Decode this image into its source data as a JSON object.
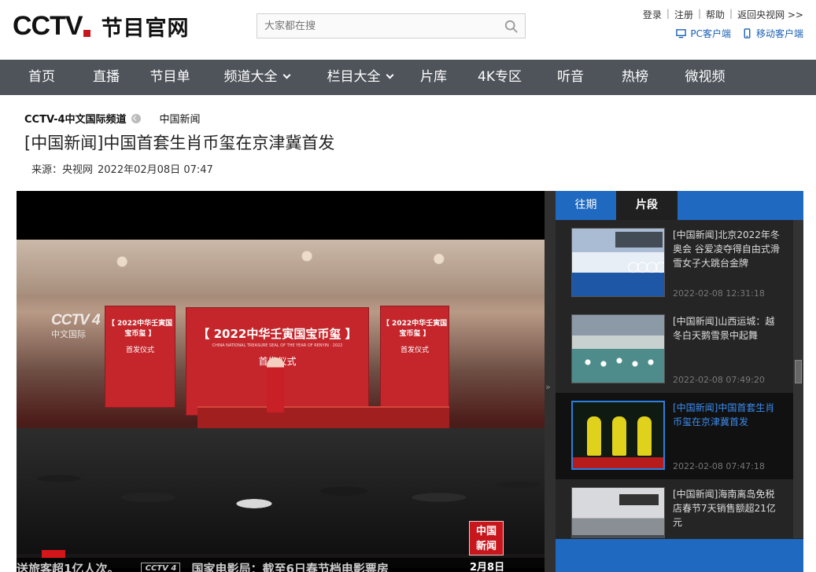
{
  "header": {
    "logo_main": "CCTV",
    "logo_sub": "节目官网",
    "search_placeholder": "大家都在搜",
    "top_links": [
      "登录",
      "注册",
      "帮助",
      "返回央视网 >>"
    ],
    "clients": [
      "PC客户端",
      "移动客户端"
    ]
  },
  "nav": {
    "items": [
      "首页",
      "直播",
      "节目单",
      "频道大全",
      "栏目大全",
      "片库",
      "4K专区",
      "听音",
      "热榜",
      "微视频"
    ]
  },
  "article": {
    "channel": "CCTV-4中文国际频道",
    "column": "中国新闻",
    "title": "[中国新闻]中国首套生肖币玺在京津冀首发",
    "source": "来源：央视网",
    "datetime": "2022年02月08日 07:47"
  },
  "video": {
    "watermark_logo": "CCTV 4",
    "watermark_sub": "中文国际",
    "panel_main_title": "【 2022中华壬寅国宝币玺 】",
    "panel_main_en": "CHINA NATIONAL TREASURE SEAL OF THE YEAR OF RENYIN · 2022",
    "panel_main_sub": "首发仪式",
    "panel_side_title": "【 2022中华壬寅国宝币玺 】",
    "panel_side_sub": "首发仪式",
    "ticker_left": "送旅客超1亿人次。",
    "ticker_bug": "CCTV 4",
    "ticker_right": "国家电影局：截至6日春节档电影票房",
    "badge_line1": "中国",
    "badge_line2": "新闻",
    "date": "2月8日"
  },
  "sidebar": {
    "tabs": [
      "往期",
      "片段"
    ],
    "active_tab": "片段",
    "items": [
      {
        "title": "[中国新闻]北京2022年冬奥会 谷爱凌夺得自由式滑雪女子大跳台金牌",
        "time": "2022-02-08 12:31:18"
      },
      {
        "title": "[中国新闻]山西运城：越冬白天鹅雪景中起舞",
        "time": "2022-02-08 07:49:20"
      },
      {
        "title": "[中国新闻]中国首套生肖币玺在京津冀首发",
        "time": "2022-02-08 07:47:18"
      },
      {
        "title": "[中国新闻]海南离岛免税店春节7天销售额超21亿元",
        "time": ""
      }
    ]
  },
  "colors": {
    "nav_bg": "#4f545b",
    "accent_blue": "#1f69c0",
    "brand_red": "#c8161d",
    "link_blue": "#1a5fb4"
  }
}
